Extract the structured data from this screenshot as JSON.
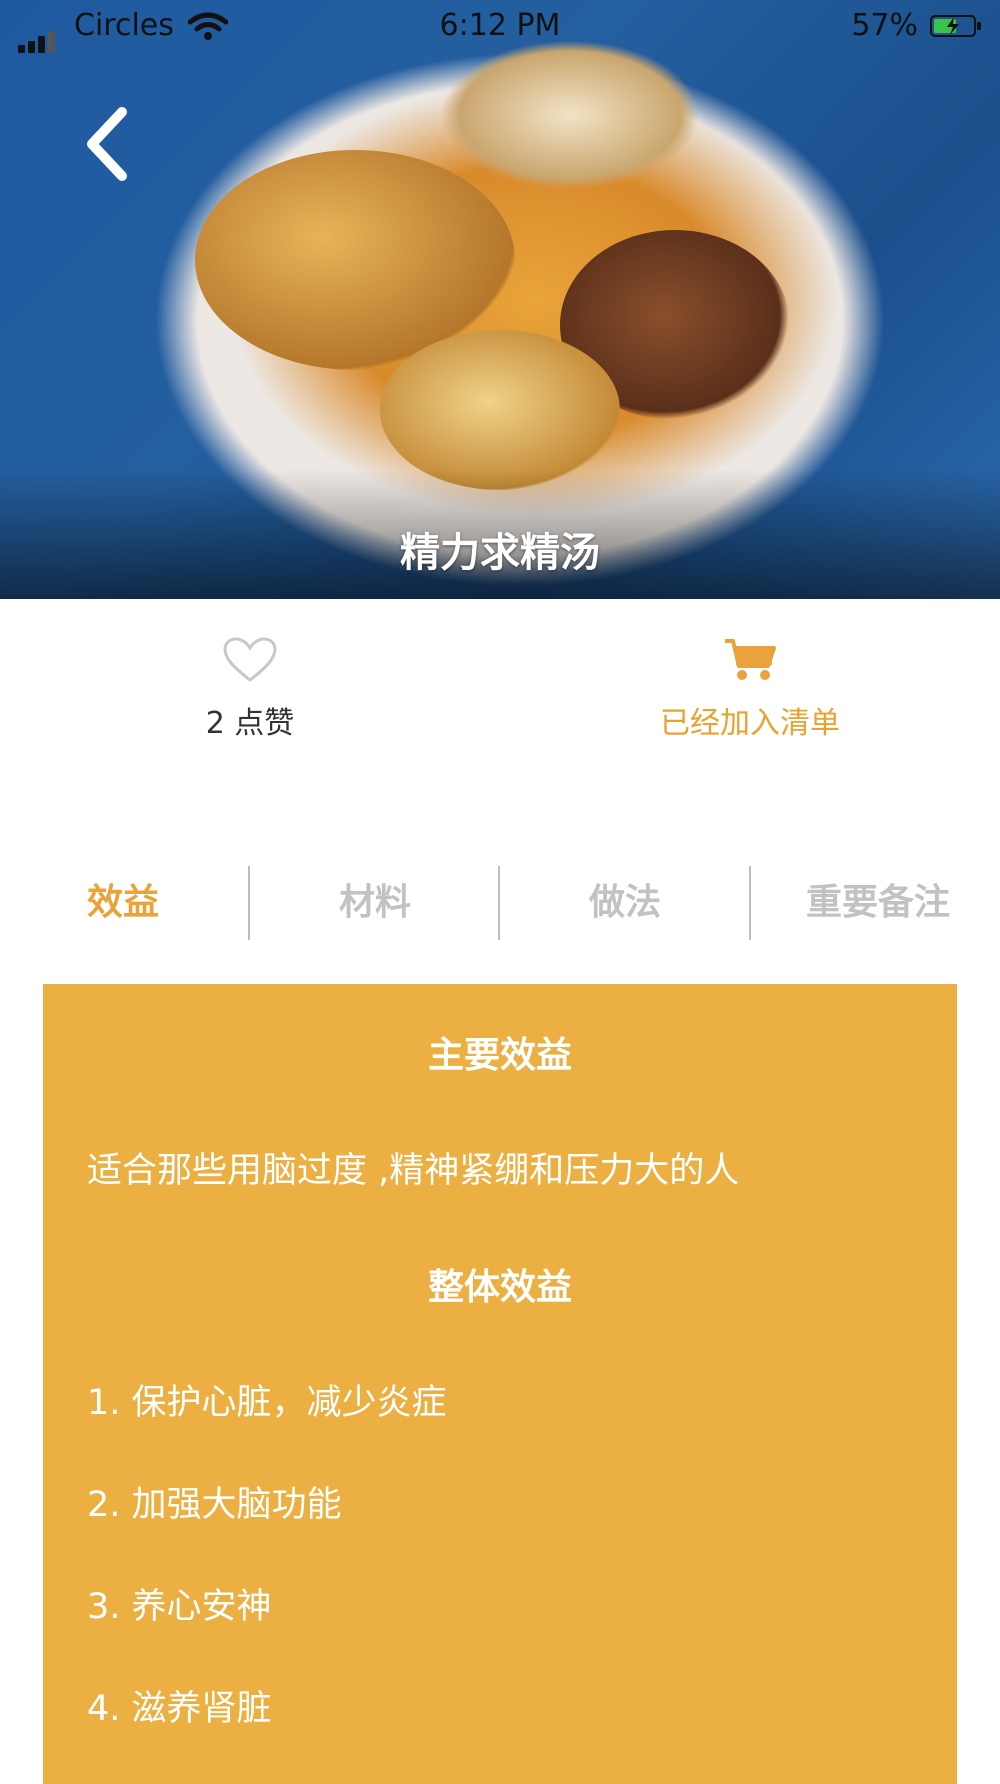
{
  "status_bar": {
    "carrier": "Circles",
    "time": "6:12 PM",
    "battery": "57%"
  },
  "hero": {
    "title": "精力求精汤"
  },
  "actions": {
    "like_label": "2 点赞",
    "cart_label": "已经加入清单"
  },
  "colors": {
    "accent": "#eaa33c",
    "panel": "#ebaf42",
    "inactive_tab": "#c2c2c2"
  },
  "tabs": [
    {
      "label": "效益",
      "active": true
    },
    {
      "label": "材料",
      "active": false
    },
    {
      "label": "做法",
      "active": false
    },
    {
      "label": "重要备注",
      "active": false
    }
  ],
  "content": {
    "main_heading": "主要效益",
    "main_text": "适合那些用脑过度 ,精神紧绷和压力大的人",
    "overall_heading": "整体效益",
    "items": [
      "1. 保护心脏，减少炎症",
      "2. 加强大脑功能",
      "3. 养心安神",
      "4. 滋养肾脏"
    ]
  }
}
